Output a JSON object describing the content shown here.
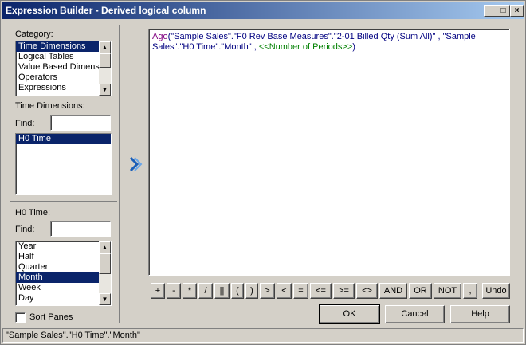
{
  "window": {
    "title": "Expression Builder - Derived logical column",
    "minimize_glyph": "_",
    "maximize_glyph": "□",
    "close_glyph": "×"
  },
  "left": {
    "category_label": "Category:",
    "category_items": [
      {
        "label": "Time Dimensions",
        "selected": true
      },
      {
        "label": "Logical Tables",
        "selected": false
      },
      {
        "label": "Value Based Dimensio",
        "selected": false
      },
      {
        "label": "Operators",
        "selected": false
      },
      {
        "label": "Expressions",
        "selected": false
      }
    ],
    "time_dimensions_label": "Time Dimensions:",
    "find_label": "Find:",
    "find_value": "",
    "time_dimension_items": [
      {
        "label": "H0 Time",
        "selected": true
      }
    ],
    "h0_time_label": "H0 Time:",
    "find2_label": "Find:",
    "find2_value": "",
    "h0_time_items": [
      {
        "label": "Year",
        "selected": false
      },
      {
        "label": "Half",
        "selected": false
      },
      {
        "label": "Quarter",
        "selected": false
      },
      {
        "label": "Month",
        "selected": true
      },
      {
        "label": "Week",
        "selected": false
      },
      {
        "label": "Day",
        "selected": false
      }
    ],
    "sort_panes_label": "Sort Panes",
    "sort_panes_checked": false
  },
  "insert_arrow_icon": "chevron-right-icon",
  "editor": {
    "fn": "Ago",
    "paren_open": "(",
    "arg1": "\"Sample Sales\".\"F0 Rev Base Measures\".\"2-01  Billed Qty  (Sum All)\"",
    "sep1": " ,  ",
    "arg2_line1": "\"Sample",
    "arg2_line2": "Sales\".\"H0 Time\".\"Month\"",
    "sep2": " , ",
    "arg3": "<<Number of Periods>>",
    "paren_close": ")"
  },
  "operators": [
    "+",
    "-",
    "*",
    "/",
    "||",
    "(",
    ")",
    ">",
    "<",
    "=",
    "<=",
    ">=",
    "<>",
    "AND",
    "OR",
    "NOT",
    ",",
    "Undo"
  ],
  "buttons": {
    "ok": "OK",
    "cancel": "Cancel",
    "help": "Help"
  },
  "status_text": "\"Sample Sales\".\"H0 Time\".\"Month\""
}
